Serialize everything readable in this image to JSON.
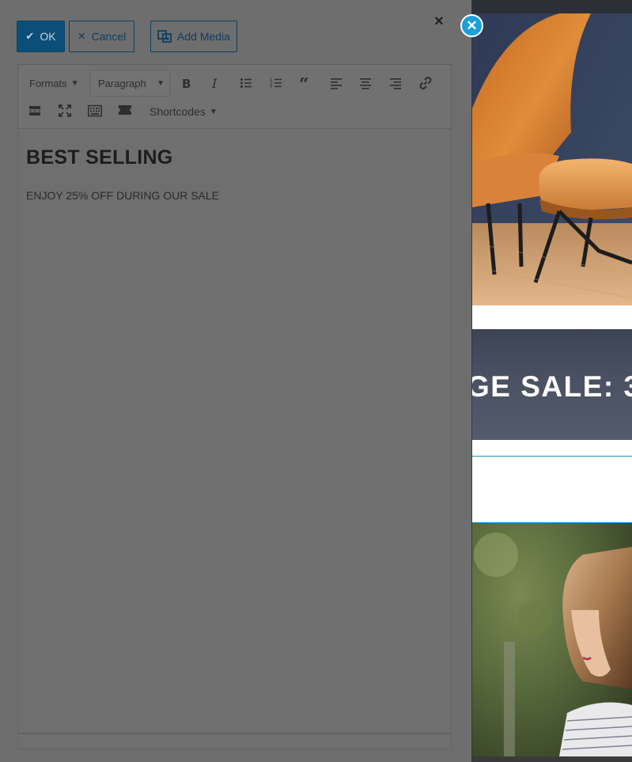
{
  "toolbar_buttons": {
    "ok_label": "OK",
    "cancel_label": "Cancel",
    "add_media_label": "Add Media"
  },
  "editor_toolbar": {
    "formats_label": "Formats",
    "block_format_value": "Paragraph",
    "shortcodes_label": "Shortcodes"
  },
  "content": {
    "heading": "BEST SELLING",
    "paragraph": "ENJOY 25% OFF DURING OUR SALE"
  },
  "preview": {
    "banner_text": "GE SALE: 3"
  },
  "colors": {
    "accent": "#1ba0d8",
    "ok_button": "#0b4f78",
    "divider": "#1f8ccd"
  }
}
